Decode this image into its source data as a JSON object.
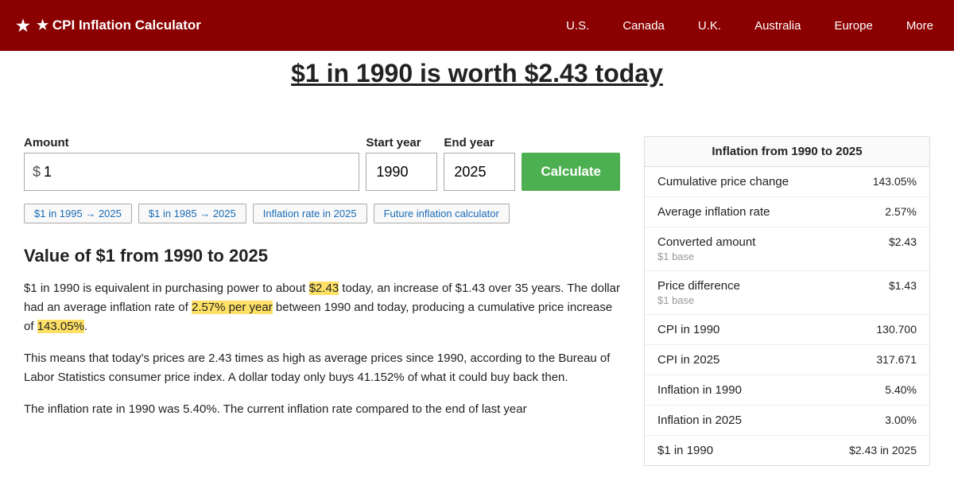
{
  "header": {
    "logo": "★ CPI Inflation Calculator",
    "nav": [
      {
        "label": "U.S.",
        "id": "nav-us"
      },
      {
        "label": "Canada",
        "id": "nav-canada"
      },
      {
        "label": "U.K.",
        "id": "nav-uk"
      },
      {
        "label": "Australia",
        "id": "nav-australia"
      },
      {
        "label": "Europe",
        "id": "nav-europe"
      },
      {
        "label": "More",
        "id": "nav-more"
      }
    ]
  },
  "page": {
    "title_prefix": "$1 in 1990 is worth ",
    "title_value": "$2.43",
    "title_suffix": " today"
  },
  "calculator": {
    "amount_label": "Amount",
    "amount_dollar_sign": "$",
    "amount_value": "1",
    "start_year_label": "Start year",
    "start_year_value": "1990",
    "end_year_label": "End year",
    "end_year_value": "2025",
    "calculate_label": "Calculate"
  },
  "quick_links": [
    {
      "label": "$1 in 1995 → 2025",
      "id": "ql-1995"
    },
    {
      "label": "$1 in 1985 → 2025",
      "id": "ql-1985"
    },
    {
      "label": "Inflation rate in 2025",
      "id": "ql-inflation"
    },
    {
      "label": "Future inflation calculator",
      "id": "ql-future"
    }
  ],
  "value_section": {
    "title": "Value of $1 from 1990 to 2025",
    "paragraph1_start": "$1 in 1990 is equivalent in purchasing power to about ",
    "paragraph1_value1": "$2.43",
    "paragraph1_mid": " today, an increase of $1.43 over 35 years. The dollar had an average inflation rate of ",
    "paragraph1_value2": "2.57% per year",
    "paragraph1_end": " between 1990 and today, producing a cumulative price increase of ",
    "paragraph1_value3": "143.05%",
    "paragraph1_final": ".",
    "paragraph2": "This means that today's prices are 2.43 times as high as average prices since 1990, according to the Bureau of Labor Statistics consumer price index. A dollar today only buys 41.152% of what it could buy back then.",
    "paragraph3_start": "The inflation rate in 1990 was 5.40%. The current inflation rate compared to the end of last year"
  },
  "inflation_table": {
    "title": "Inflation from 1990 to 2025",
    "rows": [
      {
        "label": "Cumulative price change",
        "sublabel": "",
        "value": "143.05%"
      },
      {
        "label": "Average inflation rate",
        "sublabel": "",
        "value": "2.57%"
      },
      {
        "label": "Converted amount",
        "sublabel": "$1 base",
        "value": "$2.43"
      },
      {
        "label": "Price difference",
        "sublabel": "$1 base",
        "value": "$1.43"
      },
      {
        "label": "CPI in 1990",
        "sublabel": "",
        "value": "130.700"
      },
      {
        "label": "CPI in 2025",
        "sublabel": "",
        "value": "317.671"
      },
      {
        "label": "Inflation in 1990",
        "sublabel": "",
        "value": "5.40%"
      },
      {
        "label": "Inflation in 2025",
        "sublabel": "",
        "value": "3.00%"
      },
      {
        "label": "$1 in 1990",
        "sublabel": "",
        "value": "$2.43 in 2025"
      }
    ]
  }
}
